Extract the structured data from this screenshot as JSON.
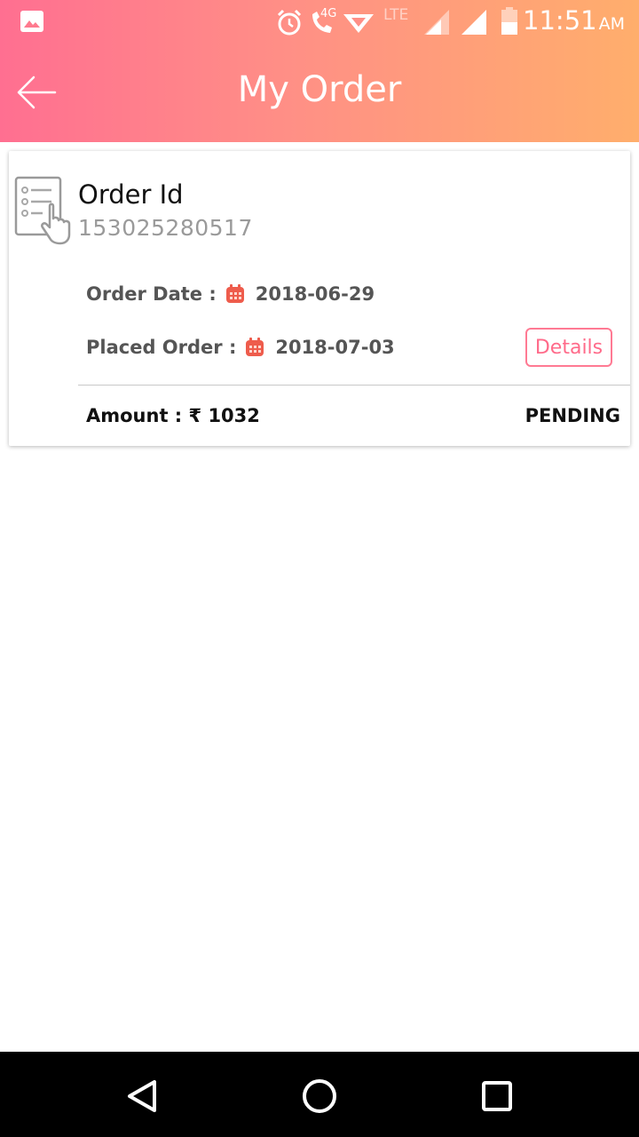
{
  "status_bar": {
    "time": "11:51",
    "ampm": "AM",
    "network": "LTE",
    "data_badge": "4G",
    "icons": [
      "gallery-icon",
      "alarm-icon",
      "volte-call-icon",
      "wifi-icon",
      "signal-icon",
      "battery-icon"
    ]
  },
  "header": {
    "title": "My Order",
    "back_icon": "arrow-left-icon",
    "gradient": [
      "#ff6f91",
      "#ffae6c"
    ]
  },
  "order": {
    "id_label": "Order Id",
    "id": "153025280517",
    "order_date_label": "Order Date :",
    "order_date": "2018-06-29",
    "placed_label": "Placed Order :",
    "placed_date": "2018-07-03",
    "details_label": "Details",
    "amount_text": "Amount : ₹ 1032",
    "status": "PENDING",
    "accent_color": "#ff6b8a"
  },
  "nav_bar": {
    "buttons": [
      "back-triangle-icon",
      "home-circle-icon",
      "recents-square-icon"
    ]
  }
}
